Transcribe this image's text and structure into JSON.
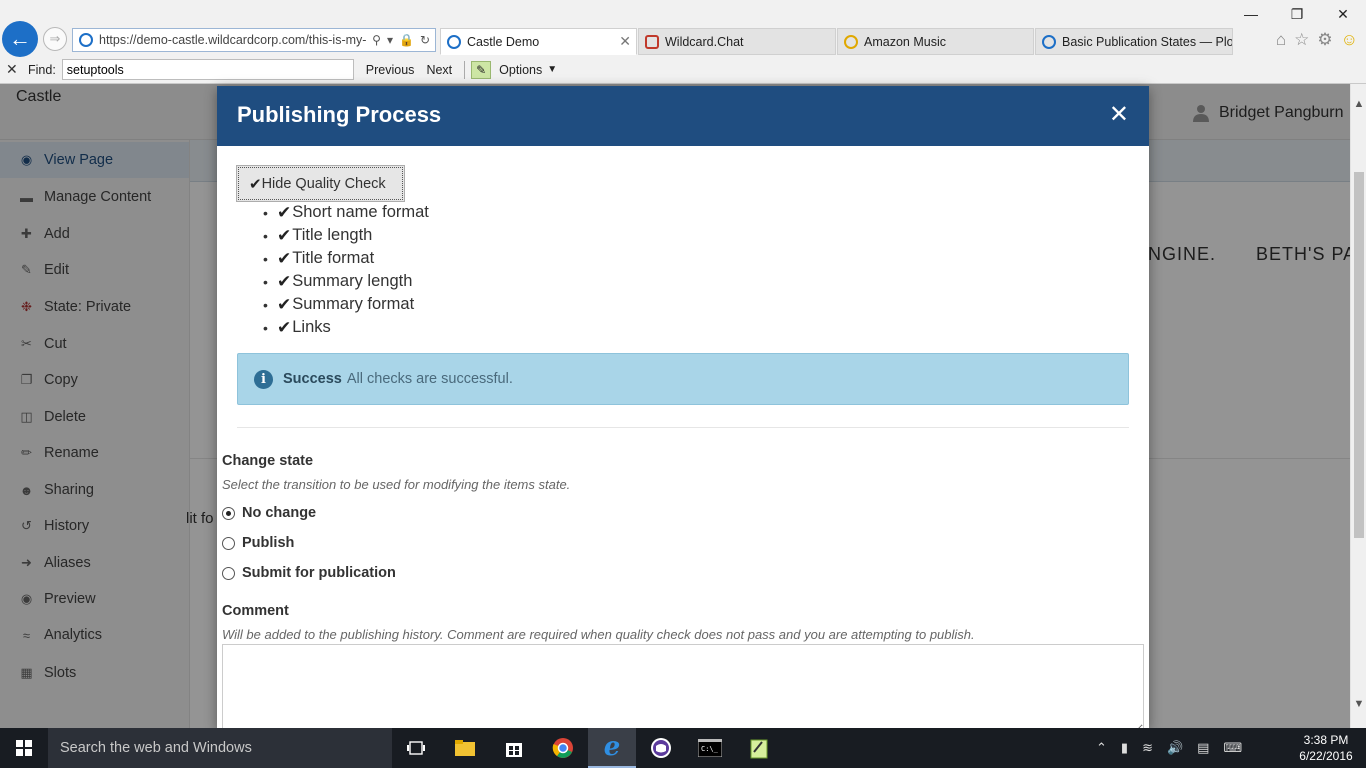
{
  "browser": {
    "url": "https://demo-castle.wildcardcorp.com/this-is-my-",
    "tabs": [
      {
        "label": "Castle Demo",
        "active": true
      },
      {
        "label": "Wildcard.Chat",
        "active": false
      },
      {
        "label": "Amazon Music",
        "active": false
      },
      {
        "label": "Basic Publication States — Plo...",
        "active": false
      }
    ],
    "find": {
      "label": "Find:",
      "value": "setuptools",
      "previous": "Previous",
      "next": "Next",
      "options": "Options"
    }
  },
  "site": {
    "name": "Castle",
    "user": "Bridget Pangburn",
    "nav": [
      "NGINE.",
      "BETH'S PAG"
    ],
    "edit_text": "lit fo"
  },
  "sidebar": {
    "items": [
      {
        "label": "View Page",
        "icon": "eye-icon"
      },
      {
        "label": "Manage Content",
        "icon": "folder-icon"
      },
      {
        "label": "Add",
        "icon": "plus-icon"
      },
      {
        "label": "Edit",
        "icon": "pencil-icon"
      },
      {
        "label": "State: Private",
        "icon": "state-icon"
      },
      {
        "label": "Cut",
        "icon": "scissors-icon"
      },
      {
        "label": "Copy",
        "icon": "copy-icon"
      },
      {
        "label": "Delete",
        "icon": "trash-icon"
      },
      {
        "label": "Rename",
        "icon": "rename-icon"
      },
      {
        "label": "Sharing",
        "icon": "users-icon"
      },
      {
        "label": "History",
        "icon": "history-icon"
      },
      {
        "label": "Aliases",
        "icon": "arrow-icon"
      },
      {
        "label": "Preview",
        "icon": "preview-icon"
      },
      {
        "label": "Analytics",
        "icon": "analytics-icon"
      },
      {
        "label": "Slots",
        "icon": "slots-icon"
      }
    ]
  },
  "modal": {
    "title": "Publishing Process",
    "quality_button": "Hide Quality Check",
    "checks": [
      "Short name format",
      "Title length",
      "Title format",
      "Summary length",
      "Summary format",
      "Links"
    ],
    "alert": {
      "title": "Success",
      "text": "All checks are successful."
    },
    "change_state": {
      "label": "Change state",
      "help": "Select the transition to be used for modifying the items state.",
      "options": [
        {
          "label": "No change",
          "selected": true
        },
        {
          "label": "Publish",
          "selected": false
        },
        {
          "label": "Submit for publication",
          "selected": false
        }
      ]
    },
    "comment": {
      "label": "Comment",
      "help": "Will be added to the publishing history. Comment are required when quality check does not pass and you are attempting to publish."
    }
  },
  "taskbar": {
    "search_placeholder": "Search the web and Windows",
    "time": "3:38 PM",
    "date": "6/22/2016"
  },
  "colors": {
    "modal_header": "#1f4d80",
    "alert_bg": "#a9d5e8",
    "accent_blue": "#1d6fc7"
  }
}
